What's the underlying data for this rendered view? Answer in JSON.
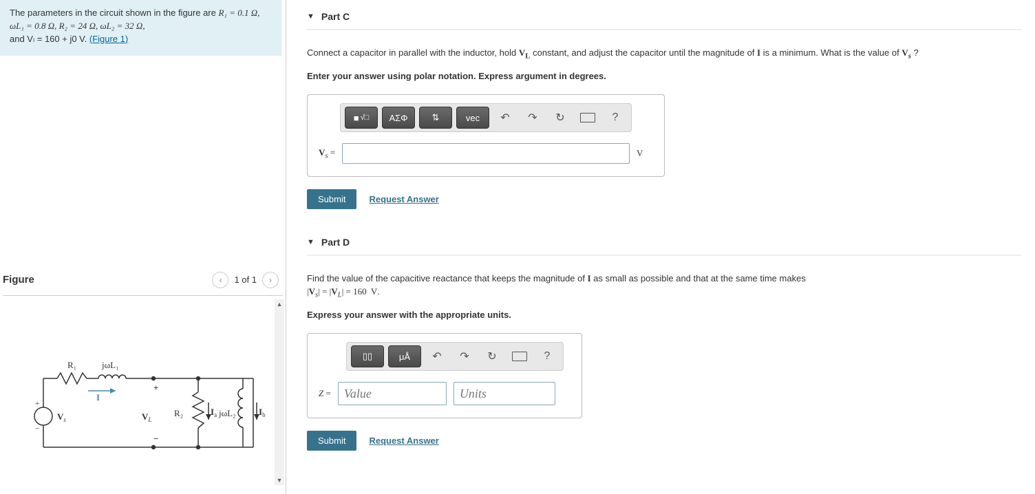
{
  "problem": {
    "intro_text": "The parameters in the circuit shown in the figure are ",
    "params_html": "R₁ = 0.1 Ω, ωL₁ = 0.8 Ω, R₂ = 24 Ω, ωL₂ = 32 Ω,",
    "cont_html": "and Vₗ = 160 + j0 V. ",
    "figure_link": "(Figure 1)"
  },
  "figure_panel": {
    "title": "Figure",
    "counter": "1 of 1",
    "labels": {
      "R1": "R₁",
      "jwL1": "jωL₁",
      "I": "I",
      "Vs": "V",
      "Vs_sub": "s",
      "VL": "V",
      "VL_sub": "L",
      "R2": "R₂",
      "Ia": "Iₐ",
      "jwL2": "jωL₂",
      "Ib": "I",
      "Ib_sub": "b"
    }
  },
  "toolbar_icons": {
    "templates": "■",
    "root": "√",
    "greek": "ΑΣΦ",
    "updown": "⇅",
    "vec": "vec",
    "undo": "↶",
    "redo": "↷",
    "reset": "↻",
    "keyboard": "⌨",
    "help": "?",
    "units_btn": "μÅ"
  },
  "parts": {
    "c": {
      "title": "Part C",
      "prompt_1": "Connect a capacitor in parallel with the inductor, hold ",
      "VL": "Vₗ",
      "prompt_2": " constant, and adjust the capacitor until the magnitude of ",
      "I": "I",
      "prompt_3": " is a minimum. What is the value of ",
      "Vs": "V",
      "Vs_sub": "s",
      "prompt_4": " ?",
      "instruction": "Enter your answer using polar notation. Express argument in degrees.",
      "var_label": "V",
      "var_sub": "s",
      "equals": " = ",
      "unit": "V",
      "submit": "Submit",
      "request": "Request Answer"
    },
    "d": {
      "title": "Part D",
      "prompt_1": "Find the value of the capacitive reactance that keeps the magnitude of ",
      "I": "I",
      "prompt_2": " as small as possible and that at the same time makes ",
      "eq_html": "|Vₛ| = |Vₗ| = 160  V.",
      "instruction": "Express your answer with the appropriate units.",
      "var_label": "Z",
      "equals": " = ",
      "value_placeholder": "Value",
      "units_placeholder": "Units",
      "submit": "Submit",
      "request": "Request Answer"
    }
  }
}
